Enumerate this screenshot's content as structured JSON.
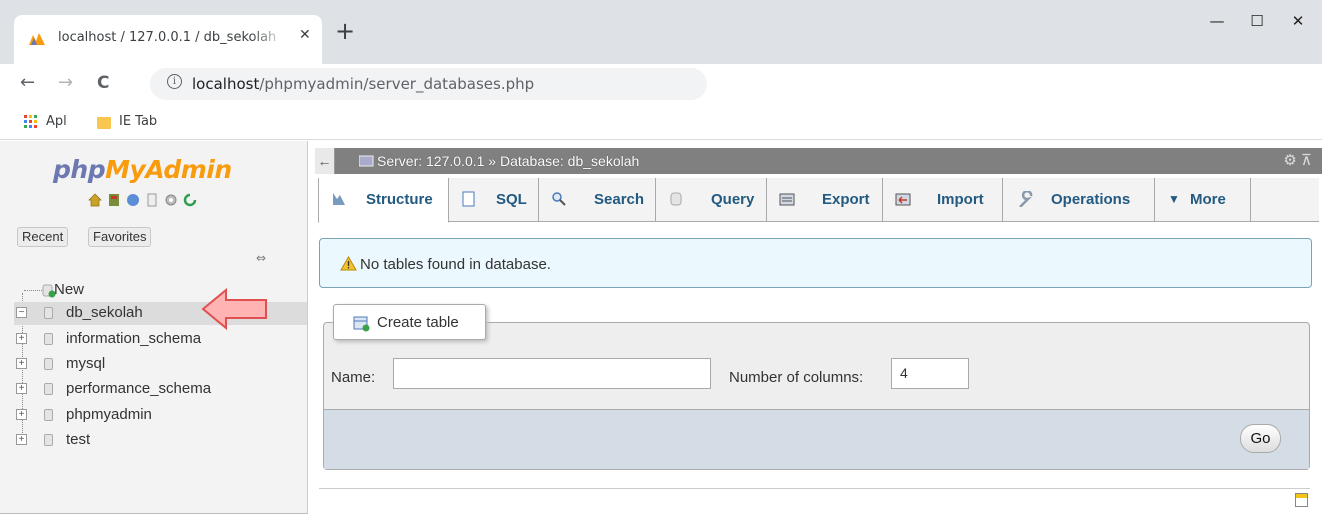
{
  "browser": {
    "tab_title": "localhost / 127.0.0.1 / db_sekolah",
    "tab_close": "✕",
    "new_tab": "+",
    "window_controls": {
      "minimize": "—",
      "maximize": "☐",
      "close": "✕"
    },
    "nav": {
      "back": "←",
      "forward": "→",
      "reload": "C"
    },
    "url_host": "localhost",
    "url_path": "/phpmyadmin/server_databases.php",
    "bookmarks": [
      "Apl",
      "IE Tab"
    ]
  },
  "sidebar": {
    "logo_php": "php",
    "logo_myadmin": "MyAdmin",
    "pills": [
      "Recent",
      "Favorites"
    ],
    "new_label": "New",
    "databases": [
      "db_sekolah",
      "information_schema",
      "mysql",
      "performance_schema",
      "phpmyadmin",
      "test"
    ],
    "selected": "db_sekolah"
  },
  "breadcrumb": {
    "text": "Server: 127.0.0.1 » Database: db_sekolah"
  },
  "tabs": [
    "Structure",
    "SQL",
    "Search",
    "Query",
    "Export",
    "Import",
    "Operations",
    "More"
  ],
  "active_tab": "Structure",
  "notice": "No tables found in database.",
  "create_table": {
    "legend": "Create table",
    "name_label": "Name:",
    "name_value": "",
    "columns_label": "Number of columns:",
    "columns_value": "4",
    "go": "Go"
  },
  "colors": {
    "accent_link": "#235a81",
    "logo_php": "#6c78af",
    "logo_myadmin": "#f89c0e",
    "arrow": "#ff9999"
  }
}
